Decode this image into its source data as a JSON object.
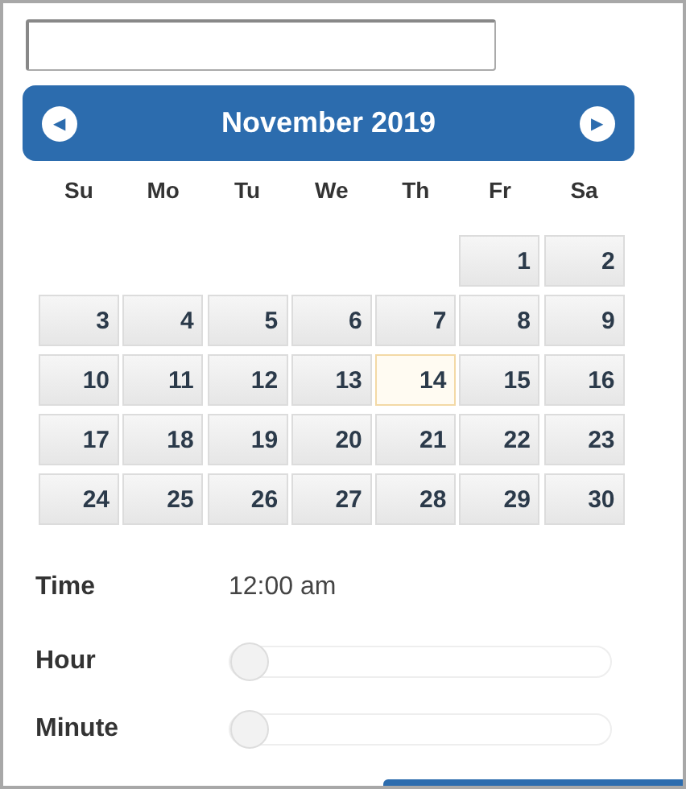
{
  "calendar": {
    "title": "November 2019",
    "prev": "◀",
    "next": "▶",
    "weekdays": [
      "Su",
      "Mo",
      "Tu",
      "We",
      "Th",
      "Fr",
      "Sa"
    ],
    "days": [
      {
        "kind": "blank"
      },
      {
        "kind": "blank"
      },
      {
        "kind": "blank"
      },
      {
        "kind": "blank"
      },
      {
        "kind": "blank"
      },
      {
        "kind": "day",
        "label": "1",
        "today": false
      },
      {
        "label": "2",
        "today": false
      },
      {
        "label": "3",
        "today": false
      },
      {
        "label": "4",
        "today": false
      },
      {
        "label": "5",
        "today": false
      },
      {
        "label": "6",
        "today": false
      },
      {
        "label": "7",
        "today": false
      },
      {
        "label": "8",
        "today": false
      },
      {
        "label": "9",
        "today": false
      },
      {
        "label": "10",
        "today": false
      },
      {
        "label": "11",
        "today": false
      },
      {
        "label": "12",
        "today": false
      },
      {
        "label": "13",
        "today": false
      },
      {
        "label": "14",
        "today": true
      },
      {
        "label": "15",
        "today": false
      },
      {
        "label": "16",
        "today": false
      },
      {
        "label": "17",
        "today": false
      },
      {
        "label": "18",
        "today": false
      },
      {
        "label": "19",
        "today": false
      },
      {
        "label": "20",
        "today": false
      },
      {
        "label": "21",
        "today": false
      },
      {
        "label": "22",
        "today": false
      },
      {
        "label": "23",
        "today": false
      },
      {
        "label": "24",
        "today": false
      },
      {
        "label": "25",
        "today": false
      },
      {
        "label": "26",
        "today": false
      },
      {
        "label": "27",
        "today": false
      },
      {
        "label": "28",
        "today": false
      },
      {
        "label": "29",
        "today": false
      },
      {
        "label": "30",
        "today": false
      }
    ]
  },
  "time": {
    "label": "Time",
    "value": "12:00 am"
  },
  "sliders": [
    {
      "label": "Hour",
      "level": 0
    },
    {
      "label": "Minute",
      "level": 0
    }
  ]
}
